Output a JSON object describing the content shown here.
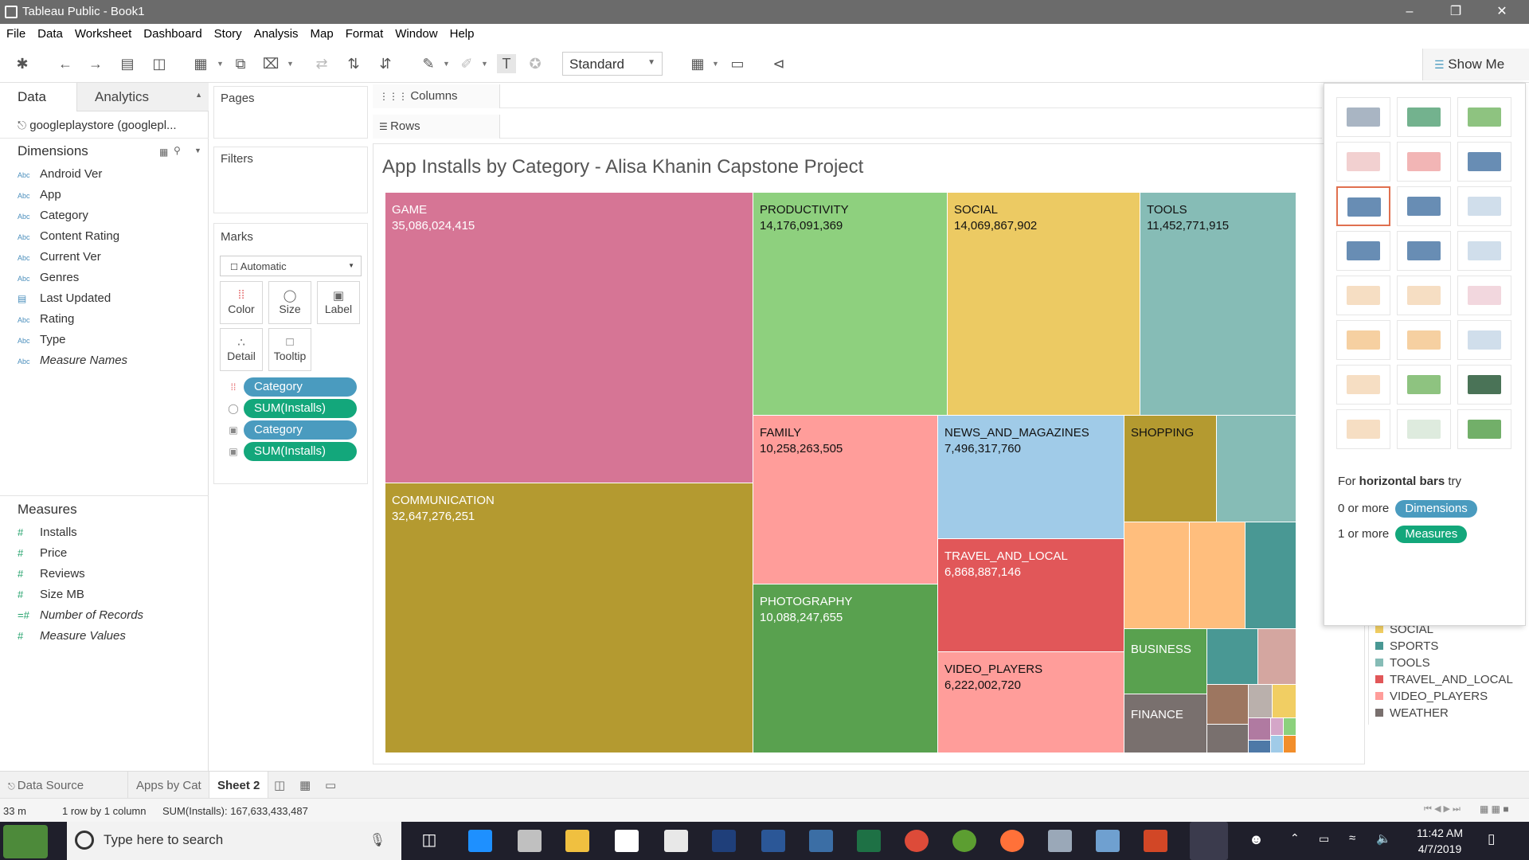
{
  "window": {
    "title": "Tableau Public - Book1"
  },
  "menu": [
    "File",
    "Data",
    "Worksheet",
    "Dashboard",
    "Story",
    "Analysis",
    "Map",
    "Format",
    "Window",
    "Help"
  ],
  "toolbar": {
    "fit_value": "Standard",
    "show_me_label": "Show Me"
  },
  "data_pane": {
    "tab_data": "Data",
    "tab_analytics": "Analytics",
    "datasource": "googleplaystore (googlepl...",
    "dimensions_title": "Dimensions",
    "dimensions": [
      {
        "icon": "Abc",
        "label": "Android Ver"
      },
      {
        "icon": "Abc",
        "label": "App"
      },
      {
        "icon": "Abc",
        "label": "Category"
      },
      {
        "icon": "Abc",
        "label": "Content Rating"
      },
      {
        "icon": "Abc",
        "label": "Current Ver"
      },
      {
        "icon": "Abc",
        "label": "Genres"
      },
      {
        "icon": "date",
        "label": "Last Updated"
      },
      {
        "icon": "Abc",
        "label": "Rating"
      },
      {
        "icon": "Abc",
        "label": "Type"
      },
      {
        "icon": "Abc",
        "label": "Measure Names"
      }
    ],
    "measures_title": "Measures",
    "measures": [
      {
        "label": "Installs"
      },
      {
        "label": "Price"
      },
      {
        "label": "Reviews"
      },
      {
        "label": "Size MB"
      },
      {
        "label": "Number of Records"
      },
      {
        "label": "Measure Values"
      }
    ]
  },
  "cards": {
    "pages": "Pages",
    "filters": "Filters",
    "marks": "Marks",
    "mark_type": "Automatic",
    "mark_buttons": [
      "Color",
      "Size",
      "Label",
      "Detail",
      "Tooltip"
    ],
    "pills": [
      "Category",
      "SUM(Installs)",
      "Category",
      "SUM(Installs)"
    ]
  },
  "shelves": {
    "columns": "Columns",
    "rows": "Rows"
  },
  "viz": {
    "title": "App Installs by Category - Alisa Khanin Capstone Project",
    "tiles": [
      {
        "name": "GAME",
        "value": "35,086,024,415",
        "color": "#d67595"
      },
      {
        "name": "COMMUNICATION",
        "value": "32,647,276,251",
        "color": "#b49a30"
      },
      {
        "name": "PRODUCTIVITY",
        "value": "14,176,091,369",
        "color": "#8ed07e"
      },
      {
        "name": "SOCIAL",
        "value": "14,069,867,902",
        "color": "#ecca63"
      },
      {
        "name": "TOOLS",
        "value": "11,452,771,915",
        "color": "#86bcb6"
      },
      {
        "name": "FAMILY",
        "value": "10,258,263,505",
        "color": "#ff9d9a"
      },
      {
        "name": "PHOTOGRAPHY",
        "value": "10,088,247,655",
        "color": "#59a14f"
      },
      {
        "name": "NEWS_AND_MAGAZINES",
        "value": "7,496,317,760",
        "color": "#a0cbe8"
      },
      {
        "name": "TRAVEL_AND_LOCAL",
        "value": "6,868,887,146",
        "color": "#e15759"
      },
      {
        "name": "VIDEO_PLAYERS",
        "value": "6,222,002,720",
        "color": "#ff9d9a"
      },
      {
        "name": "SHOPPING",
        "value": "",
        "color": "#b49a30"
      },
      {
        "name": "BUSINESS",
        "value": "",
        "color": "#59a14f"
      },
      {
        "name": "FINANCE",
        "value": "",
        "color": "#79706e"
      }
    ],
    "small_tile_colors": [
      "#86bcb6",
      "#ffbe7d",
      "#ffbe7d",
      "#499894",
      "#fabfd2",
      "#499894",
      "#d4a6a0",
      "#9d7660",
      "#bab0ac",
      "#f1ce63",
      "#79706e",
      "#b07aa1",
      "#d4a6c8",
      "#8cd17d",
      "#4e79a7",
      "#a0cbe8",
      "#f28e2b"
    ]
  },
  "legend": [
    {
      "label": "SOCIAL",
      "color": "#f1ce63"
    },
    {
      "label": "SPORTS",
      "color": "#499894"
    },
    {
      "label": "TOOLS",
      "color": "#86bcb6"
    },
    {
      "label": "TRAVEL_AND_LOCAL",
      "color": "#e15759"
    },
    {
      "label": "VIDEO_PLAYERS",
      "color": "#ff9d9a"
    },
    {
      "label": "WEATHER",
      "color": "#79706e"
    }
  ],
  "show_me": {
    "hint_prefix": "For ",
    "hint_bold": "horizontal bars",
    "hint_suffix": " try",
    "dims_prefix": "0 or more",
    "dims_pill": "Dimensions",
    "meas_prefix": "1 or more",
    "meas_pill": "Measures"
  },
  "sheet_tabs": {
    "data_source": "Data Source",
    "tabs": [
      "Apps by Cat",
      "Sheet 2"
    ]
  },
  "status": {
    "marks": "33 m",
    "rows_cols": "1 row by 1 column",
    "sum": "SUM(Installs): 167,633,433,487"
  },
  "taskbar": {
    "search_placeholder": "Type here to search",
    "time": "11:42 AM",
    "date": "4/7/2019"
  }
}
